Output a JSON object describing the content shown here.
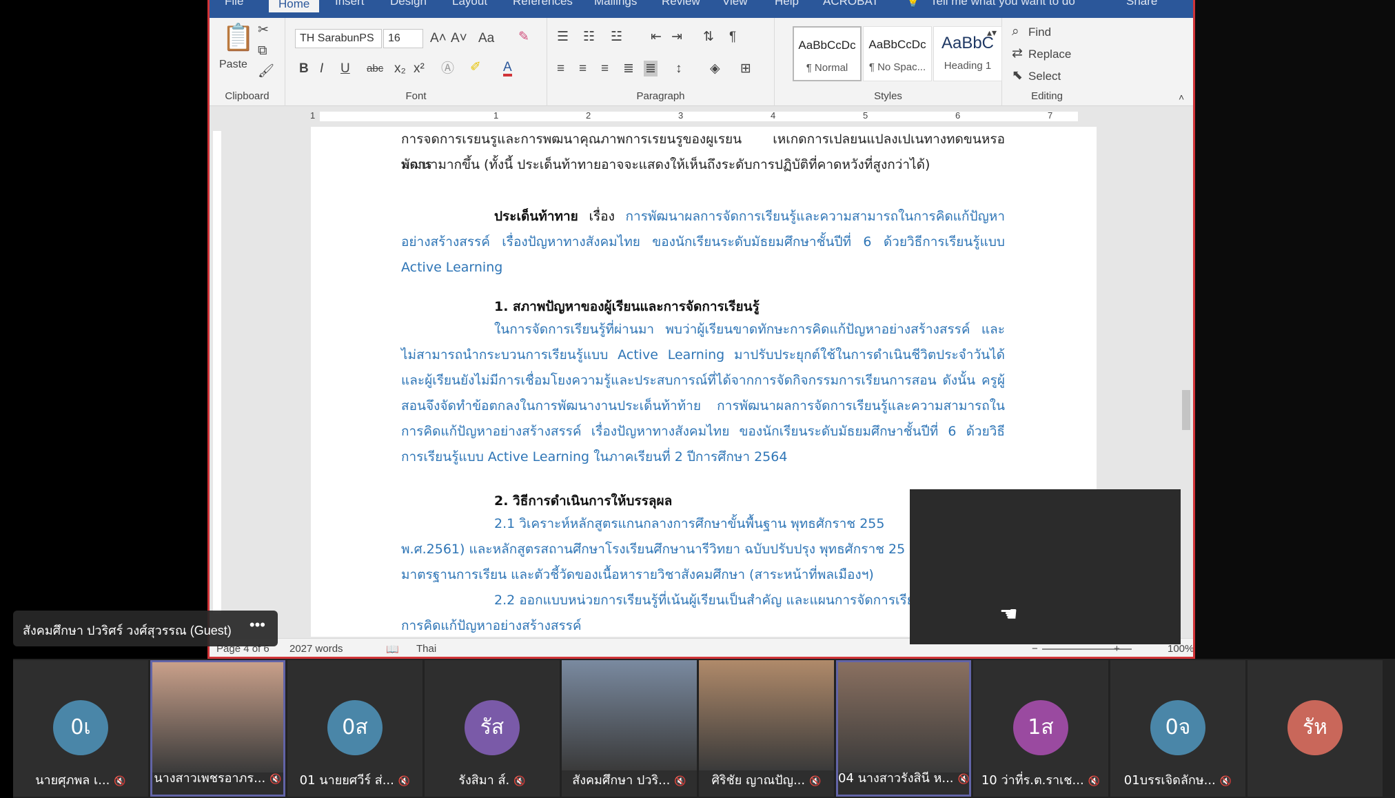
{
  "word": {
    "tabs": [
      "File",
      "Home",
      "Insert",
      "Design",
      "Layout",
      "References",
      "Mailings",
      "Review",
      "View",
      "Help",
      "ACROBAT",
      "Tell me what you want to do",
      "Share"
    ],
    "ribbon": {
      "clipboard": {
        "paste": "Paste",
        "label": "Clipboard"
      },
      "font": {
        "family": "TH SarabunPS",
        "size": "16",
        "case": "Aa",
        "bold": "B",
        "italic": "I",
        "underline": "U",
        "strike": "abc",
        "sub": "x₂",
        "sup": "x²",
        "grow": "A˄",
        "shrink": "A˅",
        "color": "A",
        "label": "Font"
      },
      "paragraph": {
        "label": "Paragraph"
      },
      "styles": {
        "label": "Styles",
        "cards": [
          {
            "sample": "AaBbCcDc",
            "name": "¶ Normal"
          },
          {
            "sample": "AaBbCcDc",
            "name": "¶ No Spac..."
          },
          {
            "sample": "AaBbC",
            "name": "Heading 1"
          }
        ]
      },
      "editing": {
        "find": "Find",
        "replace": "Replace",
        "select": "Select",
        "label": "Editing"
      }
    },
    "ruler": [
      "1",
      "1",
      "2",
      "3",
      "4",
      "5",
      "6",
      "7"
    ],
    "document": {
      "intro_line1": "การจดการเรยนรูและการพฒนาคุณภาพการเรยนรูของผูเรยน เหเกดการเปลยนแปลงเปเนทางทดขนหรอมการ",
      "intro_line2": "พัฒนามากขึ้น (ทั้งนี้ ประเด็นท้าทายอาจจะแสดงให้เห็นถึงระดับการปฏิบัติที่คาดหวังที่สูงกว่าได้)",
      "challenge_label": "ประเด็นท้าทาย",
      "challenge_word": "เรื่อง",
      "challenge_text": "การพัฒนาผลการจัดการเรียนรู้และความสามารถในการคิดแก้ปัญหาอย่างสร้างสรรค์ เรื่องปัญหาทางสังคมไทย ของนักเรียนระดับมัธยมศึกษาชั้นปีที่ 6 ด้วยวิธีการเรียนรู้แบบ Active Learning",
      "h1": "1. สภาพปัญหาของผู้เรียนและการจัดการเรียนรู้",
      "p1": "ในการจัดการเรียนรู้ที่ผ่านมา พบว่าผู้เรียนขาดทักษะการคิดแก้ปัญหาอย่างสร้างสรรค์ และไม่สามารถนำกระบวนการเรียนรู้แบบ Active Learning มาปรับประยุกต์ใช้ในการดำเนินชีวิตประจำวันได้ และผู้เรียนยังไม่มีการเชื่อมโยงความรู้และประสบการณ์ที่ได้จากการจัดกิจกรรมการเรียนการสอน ดังนั้น ครูผู้สอนจึงจัดทำข้อตกลงในการพัฒนางานประเด็นท้าท้าย การพัฒนาผลการจัดการเรียนรู้และความสามารถในการคิดแก้ปัญหาอย่างสร้างสรรค์ เรื่องปัญหาทางสังคมไทย ของนักเรียนระดับมัธยมศึกษาชั้นปีที่ 6 ด้วยวิธีการเรียนรู้แบบ Active Learning ในภาคเรียนที่ 2 ปีการศึกษา 2564",
      "h2": "2. วิธีการดำเนินการให้บรรลุผล",
      "p2_1": "2.1 วิเคราะห์หลักสูตรแกนกลางการศึกษาขั้นพื้นฐาน พุทธศักราช 255",
      "p2_2": "พ.ศ.2561) และหลักสูตรสถานศึกษาโรงเรียนศึกษานารีวิทยา ฉบับปรับปรุง พุทธศักราช 25",
      "p2_3": "มาตรฐานการเรียน และตัวชี้วัดของเนื้อหารายวิชาสังคมศึกษา (สาระหน้าที่พลเมืองฯ)",
      "p2_4": "2.2 ออกแบบหน่วยการเรียนรู้ที่เน้นผู้เรียนเป็นสำคัญ และแผนการจัดการเรีย",
      "p2_5": "การคิดแก้ปัญหาอย่างสร้างสรรค์"
    },
    "status": {
      "page": "Page 4 of 6",
      "words": "2027 words",
      "language": "Thai",
      "zoom": "100%"
    }
  },
  "meeting": {
    "presenter": "สังคมศึกษา ปวริศร์ วงศ์สุวรรณ (Guest)",
    "more": "•••",
    "participants": [
      {
        "initials": "0เ",
        "name": "นายศุภพล เ...",
        "color": "#4a86a8",
        "photo": false,
        "selected": false
      },
      {
        "initials": "",
        "name": "นางสาวเพชรอาภร...",
        "color": "#c9a08a",
        "photo": true,
        "selected": true
      },
      {
        "initials": "0ส",
        "name": "01 นายยศวีร์ ส่...",
        "color": "#4a86a8",
        "photo": false,
        "selected": false
      },
      {
        "initials": "รัส",
        "name": "รังสิมา ส์.",
        "color": "#7a5aa8",
        "photo": false,
        "selected": false
      },
      {
        "initials": "",
        "name": "สังคมศึกษา ปวริ...",
        "color": "#7a8aa0",
        "photo": true,
        "selected": false
      },
      {
        "initials": "",
        "name": "ศิริชัย ญาณปัญ...",
        "color": "#b08a6a",
        "photo": true,
        "selected": false
      },
      {
        "initials": "",
        "name": "04 นางสาวรังสินี ห...",
        "color": "#8a7060",
        "photo": true,
        "selected": true
      },
      {
        "initials": "1ส",
        "name": "10 ว่าที่ร.ต.ราเช...",
        "color": "#9a4aa0",
        "photo": false,
        "selected": false
      },
      {
        "initials": "0จ",
        "name": "01บรรเจิดลักษ...",
        "color": "#4a86a8",
        "photo": false,
        "selected": false
      },
      {
        "initials": "รัห",
        "name": "",
        "color": "#c9675a",
        "photo": false,
        "selected": false
      }
    ],
    "mic_icon": "mic-off-icon"
  }
}
